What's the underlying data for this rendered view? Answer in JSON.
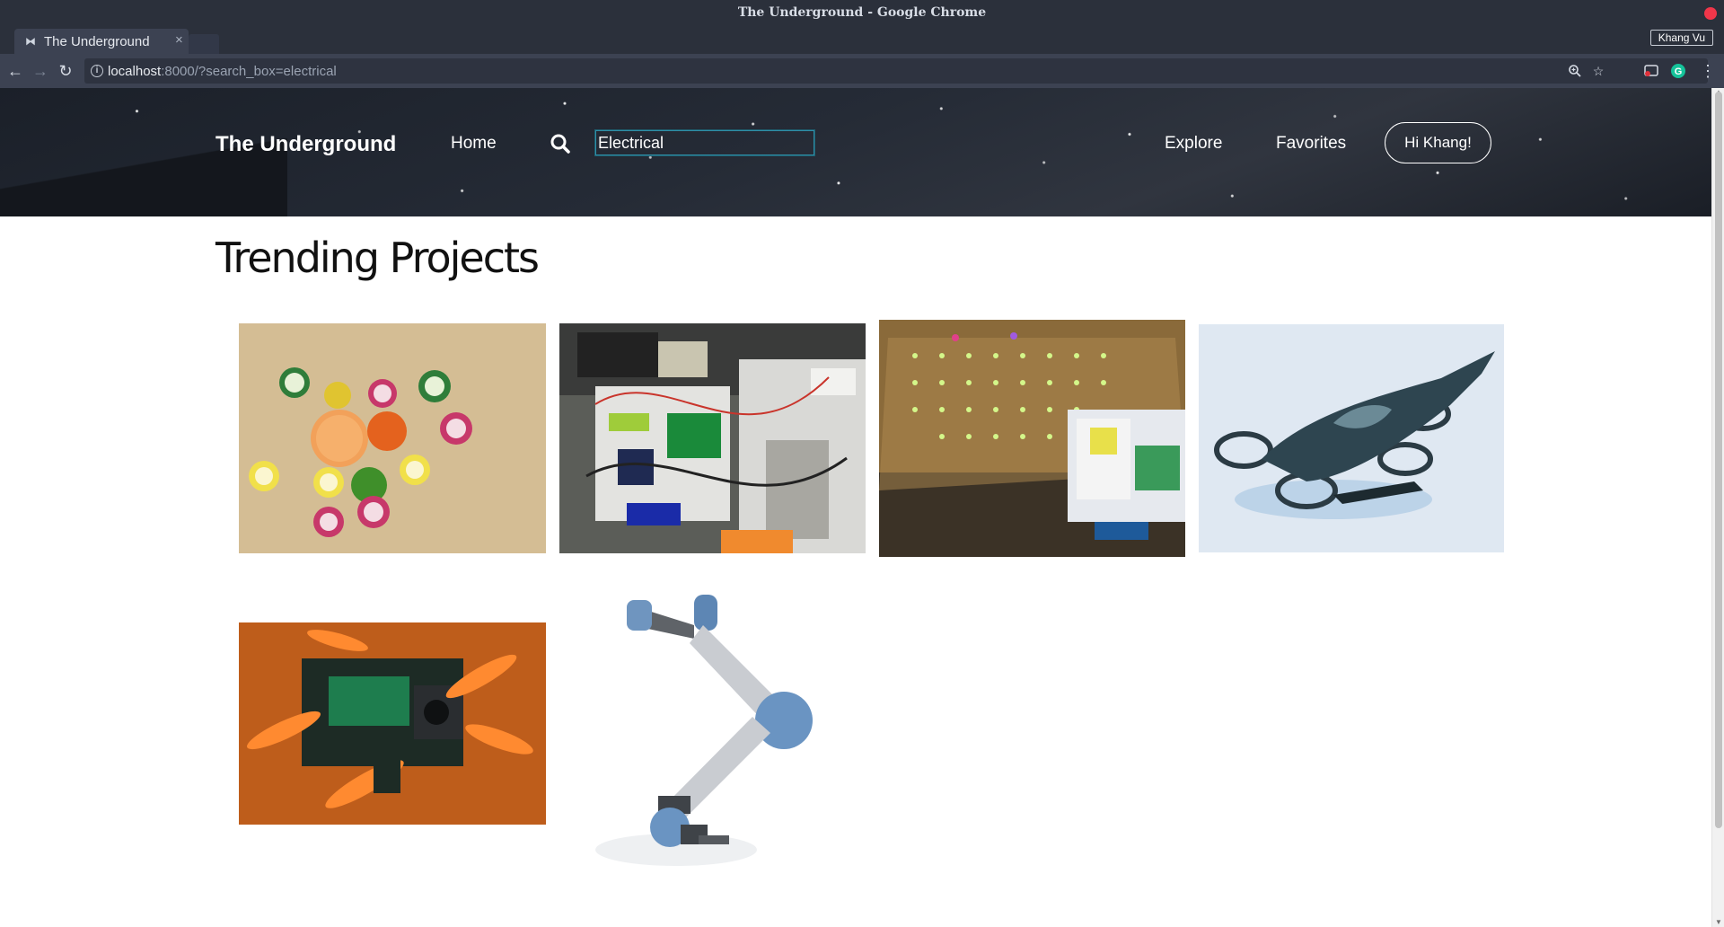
{
  "window": {
    "title": "The Underground - Google Chrome",
    "profile_name": "Khang Vu"
  },
  "tab": {
    "title": "The Underground",
    "close_glyph": "×",
    "favicon": "bowtie-icon"
  },
  "toolbar": {
    "back_glyph": "←",
    "forward_glyph": "→",
    "reload_glyph": "↻",
    "url_host": "localhost",
    "url_rest": ":8000/?search_box=electrical",
    "zoom_icon": "zoom-icon",
    "bookmark_icon": "star-icon",
    "menu_glyph": "⋮"
  },
  "site": {
    "brand": "The Underground",
    "nav": {
      "home": "Home",
      "explore": "Explore",
      "favorites": "Favorites"
    },
    "search": {
      "value": "Electrical",
      "icon": "search-icon"
    },
    "greeting_button": "Hi Khang!"
  },
  "main": {
    "heading": "Trending Projects",
    "projects": [
      {
        "subject": "citrus-fruits",
        "icon": "citrus-slices-image"
      },
      {
        "subject": "electronics-workbench",
        "icon": "breadboard-circuits-image"
      },
      {
        "subject": "led-matrix-pacman",
        "icon": "led-grid-laptop-image"
      },
      {
        "subject": "flying-car-drone",
        "icon": "quadrotor-vehicle-image"
      },
      {
        "subject": "racing-quadcopter",
        "icon": "orange-props-drone-image"
      },
      {
        "subject": "robotic-arm",
        "icon": "robot-arm-image"
      }
    ]
  },
  "colors": {
    "chrome_frame": "#2b303b",
    "chrome_toolbar": "#3c4252",
    "hero_bg": "#232832",
    "search_border": "#2f8fa8",
    "heading_text": "#111111"
  }
}
